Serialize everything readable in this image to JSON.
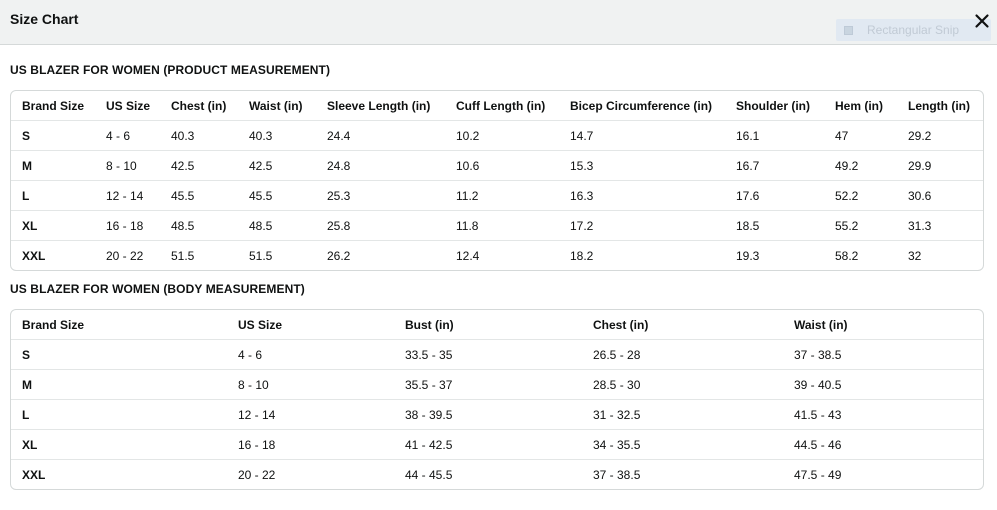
{
  "modal": {
    "title": "Size Chart",
    "close_icon": "close-icon",
    "overlay_badge": {
      "icon": "snip-icon",
      "label": "Rectangular Snip"
    }
  },
  "product_table": {
    "heading": "US BLAZER FOR WOMEN  (PRODUCT MEASUREMENT)",
    "headers": [
      "Brand Size",
      "US Size",
      "Chest (in)",
      "Waist (in)",
      "Sleeve Length (in)",
      "Cuff Length (in)",
      "Bicep Circumference (in)",
      "Shoulder (in)",
      "Hem (in)",
      "Length (in)"
    ],
    "rows": [
      [
        "S",
        "4 - 6",
        "40.3",
        "40.3",
        "24.4",
        "10.2",
        "14.7",
        "16.1",
        "47",
        "29.2"
      ],
      [
        "M",
        "8 - 10",
        "42.5",
        "42.5",
        "24.8",
        "10.6",
        "15.3",
        "16.7",
        "49.2",
        "29.9"
      ],
      [
        "L",
        "12 - 14",
        "45.5",
        "45.5",
        "25.3",
        "11.2",
        "16.3",
        "17.6",
        "52.2",
        "30.6"
      ],
      [
        "XL",
        "16 - 18",
        "48.5",
        "48.5",
        "25.8",
        "11.8",
        "17.2",
        "18.5",
        "55.2",
        "31.3"
      ],
      [
        "XXL",
        "20 - 22",
        "51.5",
        "51.5",
        "26.2",
        "12.4",
        "18.2",
        "19.3",
        "58.2",
        "32"
      ]
    ]
  },
  "body_table": {
    "heading": "US BLAZER FOR WOMEN  (BODY MEASUREMENT)",
    "headers": [
      "Brand Size",
      "US Size",
      "Bust (in)",
      "Chest (in)",
      "Waist (in)"
    ],
    "rows": [
      [
        "S",
        "4 - 6",
        "33.5 - 35",
        "26.5 - 28",
        "37 - 38.5"
      ],
      [
        "M",
        "8 - 10",
        "35.5 - 37",
        "28.5 - 30",
        "39 - 40.5"
      ],
      [
        "L",
        "12 - 14",
        "38 - 39.5",
        "31 - 32.5",
        "41.5 - 43"
      ],
      [
        "XL",
        "16 - 18",
        "41 - 42.5",
        "34 - 35.5",
        "44.5 - 46"
      ],
      [
        "XXL",
        "20 - 22",
        "44 - 45.5",
        "37 - 38.5",
        "47.5 - 49"
      ]
    ]
  }
}
